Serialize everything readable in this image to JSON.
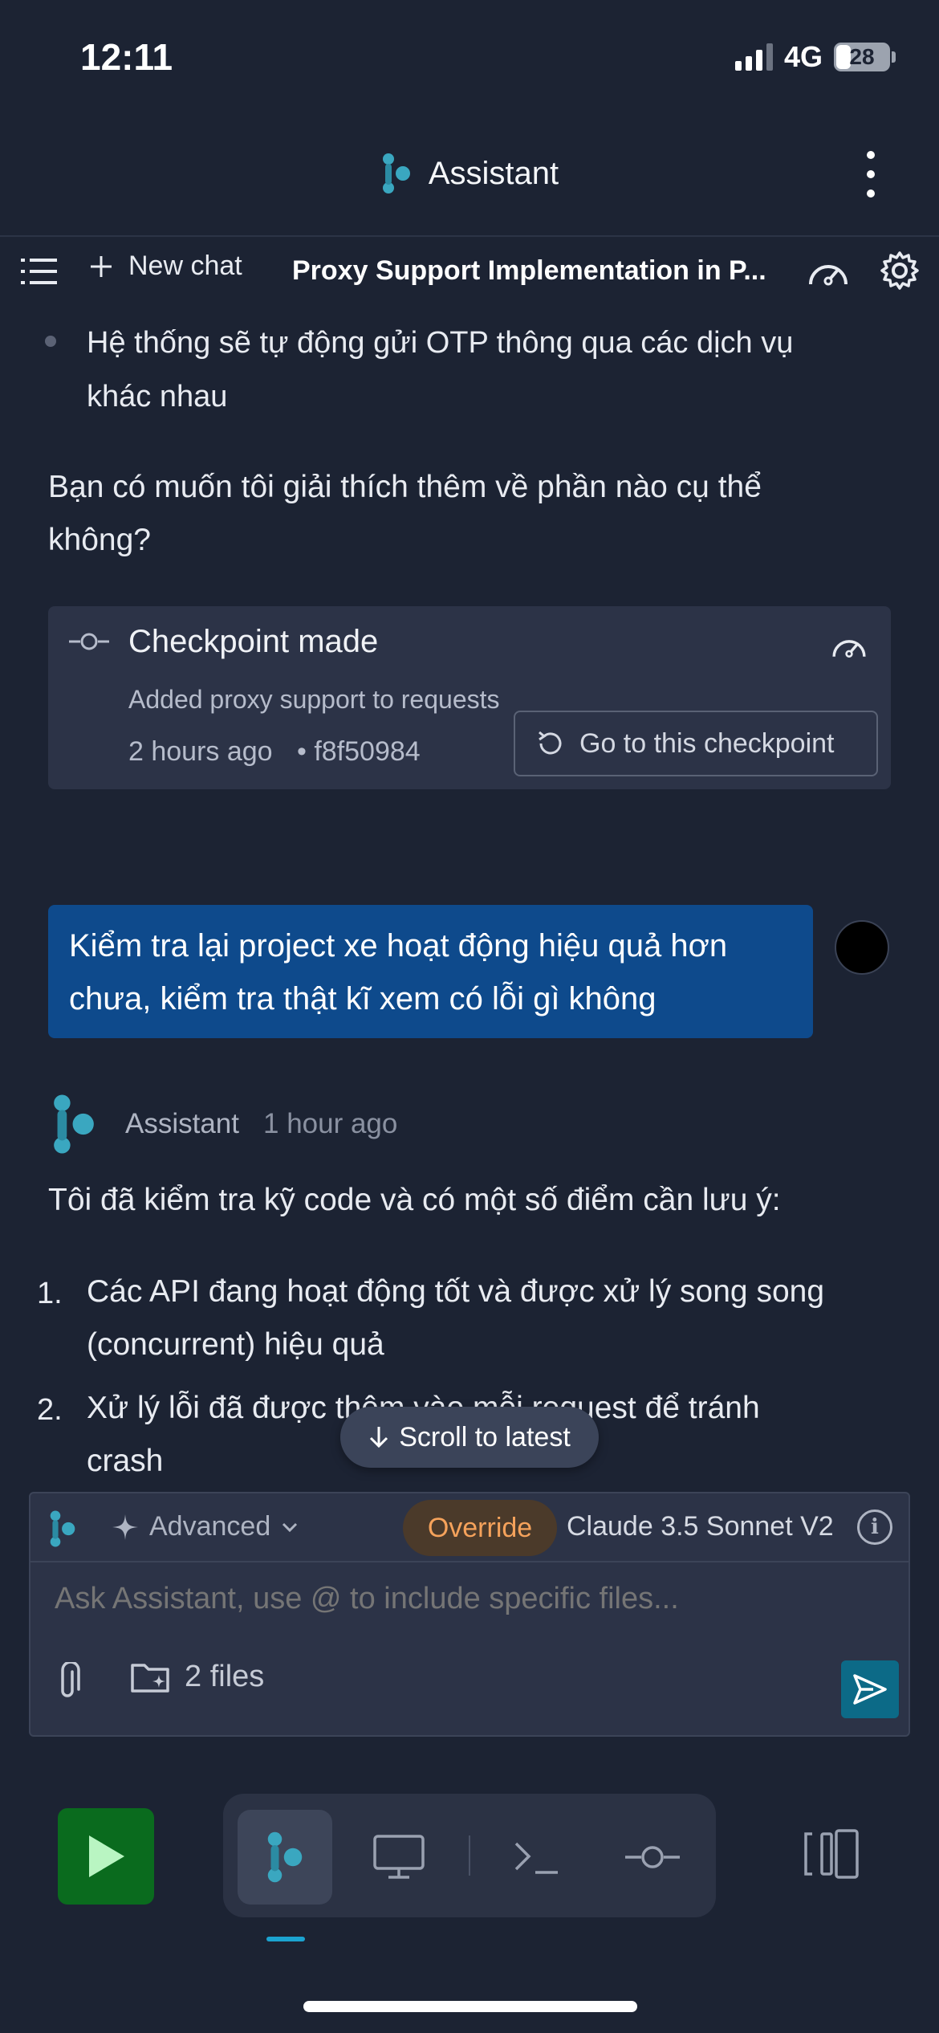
{
  "status_bar": {
    "time": "12:11",
    "network": "4G",
    "battery": "28"
  },
  "header": {
    "title": "Assistant"
  },
  "toolbar": {
    "new_chat_label": "New chat",
    "chat_title": "Proxy Support Implementation in P..."
  },
  "messages": {
    "faded_bullet": "Hệ thống sẽ tự động gửi OTP thông qua các dịch vụ",
    "faded_bullet_cont": "khác nhau",
    "question_line1": "Bạn có muốn tôi giải thích thêm về phần nào cụ thể",
    "question_line2": "không?"
  },
  "checkpoint": {
    "title": "Checkpoint made",
    "description": "Added proxy support to requests",
    "time": "2 hours ago",
    "hash": "• f8f50984",
    "button_label": "Go to this checkpoint"
  },
  "user_message": {
    "line1": "Kiểm tra lại project xe hoạt động hiệu quả hơn",
    "line2": "chưa, kiểm tra thật kĩ xem có lỗi gì không"
  },
  "assistant_reply": {
    "name": "Assistant",
    "time": "1 hour ago",
    "intro": "Tôi đã kiểm tra kỹ code và có một số điểm cần lưu ý:",
    "items": [
      {
        "num": "1.",
        "line1": "Các API đang hoạt động tốt và được xử lý song song",
        "line2": "(concurrent) hiệu quả"
      },
      {
        "num": "2.",
        "line1": "Xử lý lỗi đã được thêm vào mỗi request để tránh",
        "line2": "crash"
      }
    ]
  },
  "scroll_pill": {
    "label": "Scroll to latest"
  },
  "composer": {
    "mode": "Advanced",
    "override": "Override",
    "model": "Claude 3.5 Sonnet V2",
    "info": "i",
    "placeholder": "Ask Assistant, use @ to include specific files...",
    "files_label": "2 files"
  },
  "colors": {
    "background": "#1c2333",
    "brand": "#3aa7c0",
    "user_bubble": "#0e4a8c",
    "override": "#f5a25b",
    "run": "#0a6b1e",
    "active_tab_indicator": "#1ba3d0"
  },
  "icons": [
    "menu-icon",
    "plus-icon",
    "gauge-icon",
    "gear-icon",
    "commit-icon",
    "history-icon",
    "sparkle-icon",
    "chevron-down-icon",
    "info-icon",
    "paperclip-icon",
    "folder-icon",
    "send-icon",
    "play-icon",
    "assistant-logo-icon",
    "monitor-icon",
    "terminal-icon",
    "panels-icon",
    "arrow-down-icon"
  ]
}
